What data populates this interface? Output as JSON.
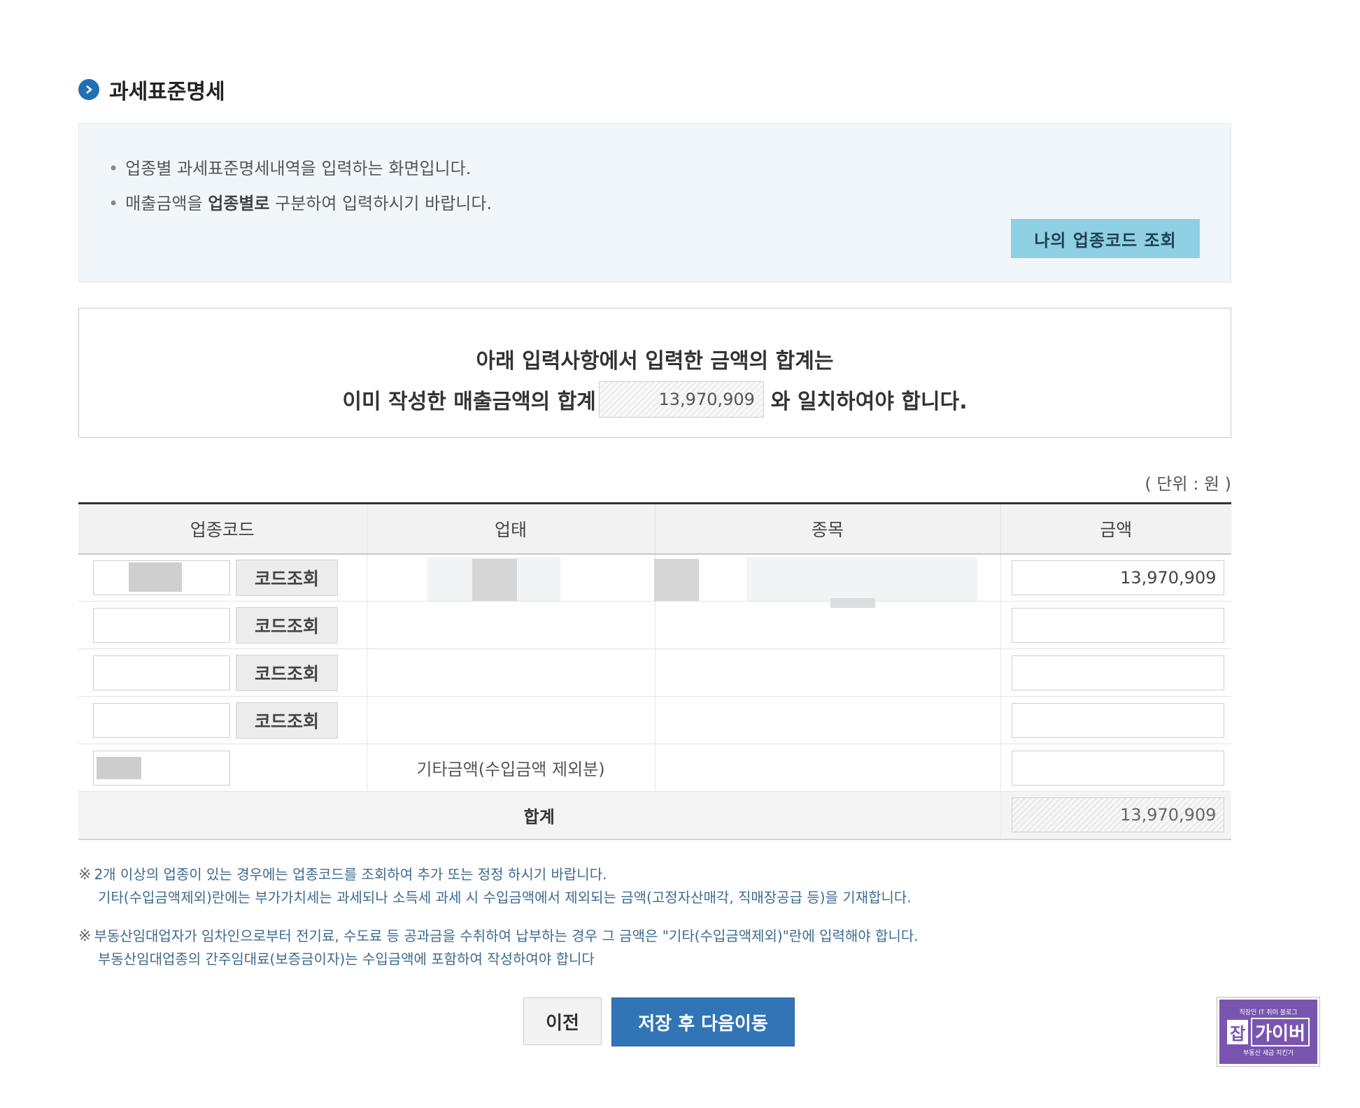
{
  "section": {
    "title": "과세표준명세"
  },
  "info": {
    "line1": "업종별 과세표준명세내역을 입력하는 화면입니다.",
    "line2_prefix": "매출금액을 ",
    "line2_bold": "업종별로",
    "line2_suffix": " 구분하여 입력하시기 바랍니다.",
    "lookup_button": "나의 업종코드 조회"
  },
  "notice": {
    "line1": "아래 입력사항에서  입력한 금액의 합계는",
    "line2_prefix": "이미 작성한 매출금액의 합계",
    "sum_value": "13,970,909",
    "line2_suffix": "와 일치하여야 합니다."
  },
  "unit": "( 단위 : 원 )",
  "table": {
    "headers": [
      "업종코드",
      "업태",
      "종목",
      "금액"
    ],
    "code_button": "코드조회",
    "rows": [
      {
        "amount": "13,970,909"
      },
      {
        "amount": ""
      },
      {
        "amount": ""
      },
      {
        "amount": ""
      }
    ],
    "other_label": "기타금액(수입금액 제외분)",
    "other_amount": "",
    "total_label": "합계",
    "total_amount": "13,970,909"
  },
  "notes": {
    "mark": "※",
    "note1_line1": "2개 이상의 업종이 있는 경우에는 업종코드를 조회하여 추가 또는 정정 하시기 바랍니다.",
    "note1_line2": "기타(수입금액제외)란에는 부가가치세는 과세되나 소득세 과세 시 수입금액에서 제외되는 금액(고정자산매각, 직매장공급 등)을 기재합니다.",
    "note2_line1": "부동산임대업자가 임차인으로부터 전기료, 수도료 등 공과금을 수취하여 납부하는 경우 그 금액은 \"기타(수입금액제외)\"란에 입력해야 합니다.",
    "note2_line2": "부동산임대업종의 간주임대료(보증금이자)는 수입금액에 포함하여 작성하여야 합니다"
  },
  "buttons": {
    "prev": "이전",
    "next": "저장 후 다음이동"
  },
  "watermark": {
    "top": "직장인 IT 취미 블로그",
    "jab": "잡",
    "name": "가이버",
    "bottom": "부동산 세금 지킨거"
  },
  "colors": {
    "accent": "#1f6fb3",
    "next_button": "#3175b7",
    "lookup_button": "#8fcfe3",
    "info_bg": "#f1f6fb",
    "note_text": "#3d6b8f",
    "watermark_bg": "#7a55b0"
  }
}
